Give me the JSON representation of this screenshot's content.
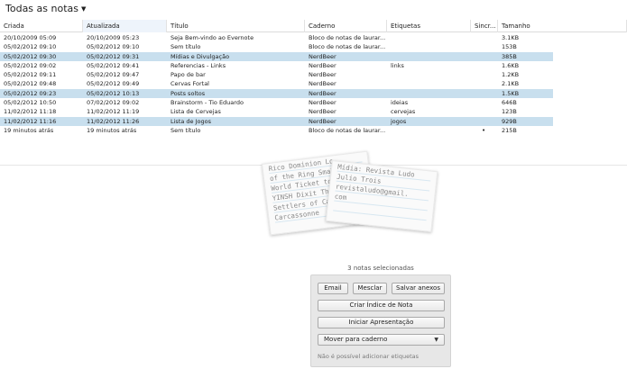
{
  "view_menu": {
    "label": "Todas as notas",
    "icon": "caret-down-icon"
  },
  "columns": [
    "Criada",
    "Atualizada",
    "Título",
    "Caderno",
    "Etiquetas",
    "Sincr...",
    "Tamanho"
  ],
  "rows": [
    {
      "criada": "20/10/2009 05:09",
      "atualizada": "20/10/2009 05:23",
      "titulo": "Seja Bem-vindo ao Evernote",
      "caderno": "Bloco de notas de laurar...",
      "etiquetas": "",
      "sinc": "",
      "tamanho": "3.1KB",
      "selected": false
    },
    {
      "criada": "05/02/2012 09:10",
      "atualizada": "05/02/2012 09:10",
      "titulo": "Sem título",
      "caderno": "Bloco de notas de laurar...",
      "etiquetas": "",
      "sinc": "",
      "tamanho": "153B",
      "selected": false
    },
    {
      "criada": "05/02/2012 09:30",
      "atualizada": "05/02/2012 09:31",
      "titulo": "Mídias e Divulgação",
      "caderno": "NerdBeer",
      "etiquetas": "",
      "sinc": "",
      "tamanho": "385B",
      "selected": true
    },
    {
      "criada": "05/02/2012 09:02",
      "atualizada": "05/02/2012 09:41",
      "titulo": "Referencias - Links",
      "caderno": "NerdBeer",
      "etiquetas": "links",
      "sinc": "",
      "tamanho": "1.6KB",
      "selected": false
    },
    {
      "criada": "05/02/2012 09:11",
      "atualizada": "05/02/2012 09:47",
      "titulo": "Papo de bar",
      "caderno": "NerdBeer",
      "etiquetas": "",
      "sinc": "",
      "tamanho": "1.2KB",
      "selected": false
    },
    {
      "criada": "05/02/2012 09:48",
      "atualizada": "05/02/2012 09:49",
      "titulo": "Cervas Fortal",
      "caderno": "NerdBeer",
      "etiquetas": "",
      "sinc": "",
      "tamanho": "2.1KB",
      "selected": false
    },
    {
      "criada": "05/02/2012 09:23",
      "atualizada": "05/02/2012 10:13",
      "titulo": "Posts soltos",
      "caderno": "NerdBeer",
      "etiquetas": "",
      "sinc": "",
      "tamanho": "1.5KB",
      "selected": true
    },
    {
      "criada": "05/02/2012 10:50",
      "atualizada": "07/02/2012 09:02",
      "titulo": "Brainstorm - Tio Eduardo",
      "caderno": "NerdBeer",
      "etiquetas": "ideias",
      "sinc": "",
      "tamanho": "646B",
      "selected": false
    },
    {
      "criada": "11/02/2012 11:18",
      "atualizada": "11/02/2012 11:19",
      "titulo": "Lista de Cervejas",
      "caderno": "NerdBeer",
      "etiquetas": "cervejas",
      "sinc": "",
      "tamanho": "123B",
      "selected": false
    },
    {
      "criada": "11/02/2012 11:16",
      "atualizada": "11/02/2012 11:26",
      "titulo": "Lista de Jogos",
      "caderno": "NerdBeer",
      "etiquetas": "jogos",
      "sinc": "",
      "tamanho": "929B",
      "selected": true
    },
    {
      "criada": "19 minutos atrás",
      "atualizada": "19 minutos atrás",
      "titulo": "Sem título",
      "caderno": "Bloco de notas de laurar...",
      "etiquetas": "",
      "sinc": "•",
      "tamanho": "215B",
      "selected": false
    }
  ],
  "preview_cards": {
    "card_a": [
      "Rico Dominion Lo",
      "of the Ring Small",
      "World Ticket to Ride",
      "YINSH Dixit The",
      "Settlers of Catan",
      "Carcassonne"
    ],
    "card_b": [
      "Mídia: Revista Ludo",
      "Julio Trois",
      "revistaludo@gmail.",
      "com"
    ]
  },
  "selection": {
    "count_label": "3 notas selecionadas",
    "email": "Email",
    "mesclar": "Mesclar",
    "salvar_anexos": "Salvar anexos",
    "criar_indice": "Criar Índice de Nota",
    "iniciar_apresentacao": "Iniciar Apresentação",
    "mover_para_caderno": "Mover para caderno",
    "tags_note": "Não é possível adicionar etiquetas"
  },
  "colors": {
    "selected_row": "#c8dfee",
    "panel_bg": "#e7e7e7"
  }
}
